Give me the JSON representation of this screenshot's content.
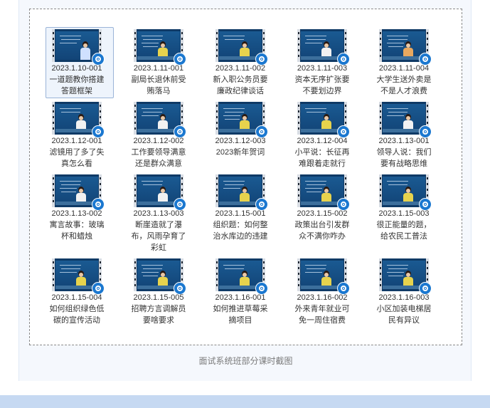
{
  "gallery": {
    "items": [
      {
        "title": "2023.1.10-001",
        "line2": "一道题教你搭建",
        "line3": "答题框架",
        "shirt": "#cfe0ff",
        "selected": true
      },
      {
        "title": "2023.1.11-001",
        "line2": "副局长退休前受",
        "line3": "贿落马",
        "shirt": "#e7d34d"
      },
      {
        "title": "2023.1.11-002",
        "line2": "新入职公务员要",
        "line3": "廉政纪律谈话",
        "shirt": "#e7d34d"
      },
      {
        "title": "2023.1.11-003",
        "line2": "资本无序扩张要",
        "line3": "不要划边界",
        "shirt": "#f2f2f2"
      },
      {
        "title": "2023.1.11-004",
        "line2": "大学生送外卖是",
        "line3": "不是人才浪费",
        "shirt": "#e8a85f"
      },
      {
        "title": "2023.1.12-001",
        "line2": "滤镜用了多了失",
        "line3": "真怎么看",
        "shirt": "#f2f2f2"
      },
      {
        "title": "2023.1.12-002",
        "line2": "工作要领导满意",
        "line3": "还是群众满意",
        "shirt": "#f2f2f2"
      },
      {
        "title": "2023.1.12-003",
        "line2": "2023新年贺词",
        "line3": "",
        "shirt": "#e7d34d"
      },
      {
        "title": "2023.1.12-004",
        "line2": "小平说：长征再",
        "line3": "难跟着走就行",
        "shirt": "#e7d34d"
      },
      {
        "title": "2023.1.13-001",
        "line2": "领导人说：我们",
        "line3": "要有战略思维",
        "shirt": "#f2f2f2"
      },
      {
        "title": "2023.1.13-002",
        "line2": "寓言故事：玻璃",
        "line3": "杯和蜡烛",
        "shirt": "#f2f2f2"
      },
      {
        "title": "2023.1.13-003",
        "line2": "断崖造就了瀑",
        "line3": "布，风雨孕育了",
        "line4": "彩虹",
        "shirt": "#f2f2f2"
      },
      {
        "title": "2023.1.15-001",
        "line2": "组织题：如何整",
        "line3": "治水库边的违建",
        "shirt": "#e7d34d"
      },
      {
        "title": "2023.1.15-002",
        "line2": "政策出台引发群",
        "line3": "众不满你咋办",
        "shirt": "#e7d34d"
      },
      {
        "title": "2023.1.15-003",
        "line2": "很正能量的题，",
        "line3": "给农民工普法",
        "shirt": "#e7d34d"
      },
      {
        "title": "2023.1.15-004",
        "line2": "如何组织绿色低",
        "line3": "碳的宣传活动",
        "shirt": "#e7d34d"
      },
      {
        "title": "2023.1.15-005",
        "line2": "招聘方言调解员",
        "line3": "要啥要求",
        "shirt": "#e7d34d"
      },
      {
        "title": "2023.1.16-001",
        "line2": "如何推进草莓采",
        "line3": "摘项目",
        "shirt": "#e7d34d"
      },
      {
        "title": "2023.1.16-002",
        "line2": "外来青年就业可",
        "line3": "免一周住宿费",
        "shirt": "#e7d34d"
      },
      {
        "title": "2023.1.16-003",
        "line2": "小区加装电梯居",
        "line3": "民有异议",
        "shirt": "#e7d34d"
      }
    ]
  },
  "caption": "面试系统班部分课时截图",
  "colors": {
    "panel_bg": "#f5f8fd",
    "bottom_band": "#c6d9f2",
    "badge": "#1b78d0",
    "thumb_bg": "#124477"
  }
}
